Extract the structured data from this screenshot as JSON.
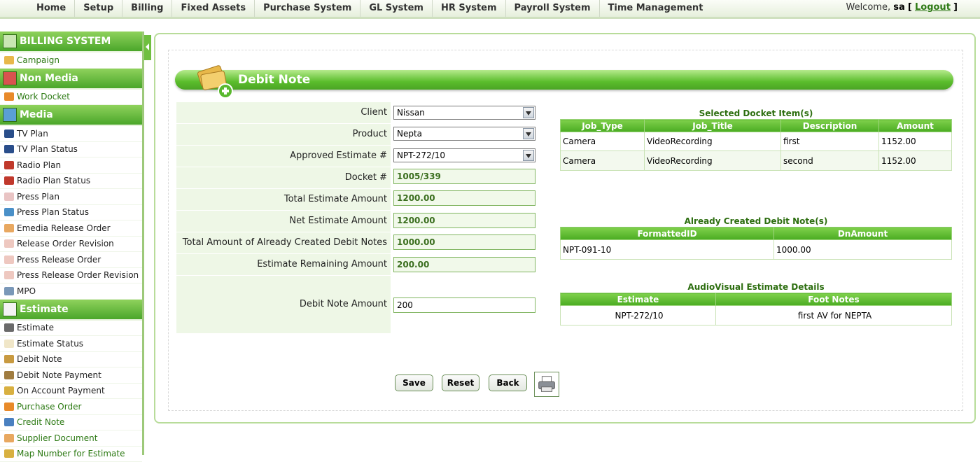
{
  "topnav": {
    "menu": [
      "Home",
      "Setup",
      "Billing",
      "Fixed Assets",
      "Purchase System",
      "GL System",
      "HR System",
      "Payroll System",
      "Time Management"
    ],
    "welcome_prefix": "Welcome,",
    "user": "sa",
    "open_bracket": "[",
    "logout": "Logout",
    "close_bracket": "]"
  },
  "sidebar": {
    "billing_header": "BILLING SYSTEM",
    "campaign": "Campaign",
    "nonmedia_header": "Non Media",
    "work_docket": "Work Docket",
    "media_header": "Media",
    "media_items": [
      "TV Plan",
      "TV Plan Status",
      "Radio Plan",
      "Radio Plan Status",
      "Press Plan",
      "Press Plan Status",
      "Emedia Release Order",
      "Release Order Revision",
      "Press Release Order",
      "Press Release Order Revision",
      "MPO"
    ],
    "estimate_header": "Estimate",
    "estimate_items": [
      "Estimate",
      "Estimate Status",
      "Debit Note",
      "Debit Note Payment",
      "On Account Payment",
      "Purchase Order",
      "Credit Note",
      "Supplier Document",
      "Map Number for Estimate"
    ]
  },
  "page": {
    "title": "Debit Note"
  },
  "form": {
    "client_label": "Client",
    "client_value": "Nissan",
    "product_label": "Product",
    "product_value": "Nepta",
    "approved_label": "Approved Estimate #",
    "approved_value": "NPT-272/10",
    "docket_label": "Docket #",
    "docket_value": "1005/339",
    "total_est_label": "Total Estimate Amount",
    "total_est_value": "1200.00",
    "net_est_label": "Net Estimate Amount",
    "net_est_value": "1200.00",
    "created_label": "Total Amount of Already Created Debit Notes",
    "created_value": "1000.00",
    "remaining_label": "Estimate Remaining Amount",
    "remaining_value": "200.00",
    "dn_amount_label": "Debit Note Amount",
    "dn_amount_value": "200"
  },
  "docket_grid": {
    "caption": "Selected Docket Item(s)",
    "headers": [
      "Job_Type",
      "Job_Title",
      "Description",
      "Amount"
    ],
    "rows": [
      [
        "Camera",
        "VideoRecording",
        "first",
        "1152.00"
      ],
      [
        "Camera",
        "VideoRecording",
        "second",
        "1152.00"
      ]
    ]
  },
  "created_grid": {
    "caption": "Already Created Debit Note(s)",
    "headers": [
      "FormattedID",
      "DnAmount"
    ],
    "rows": [
      [
        "NPT-091-10",
        "1000.00"
      ]
    ]
  },
  "av_grid": {
    "caption": "AudioVisual Estimate Details",
    "headers": [
      "Estimate",
      "Foot Notes"
    ],
    "rows": [
      [
        "NPT-272/10",
        "first AV for NEPTA"
      ]
    ]
  },
  "buttons": {
    "save": "Save",
    "reset": "Reset",
    "back": "Back"
  },
  "colors": {
    "accent": "#4aa62a",
    "accent_light": "#eef7e6"
  }
}
